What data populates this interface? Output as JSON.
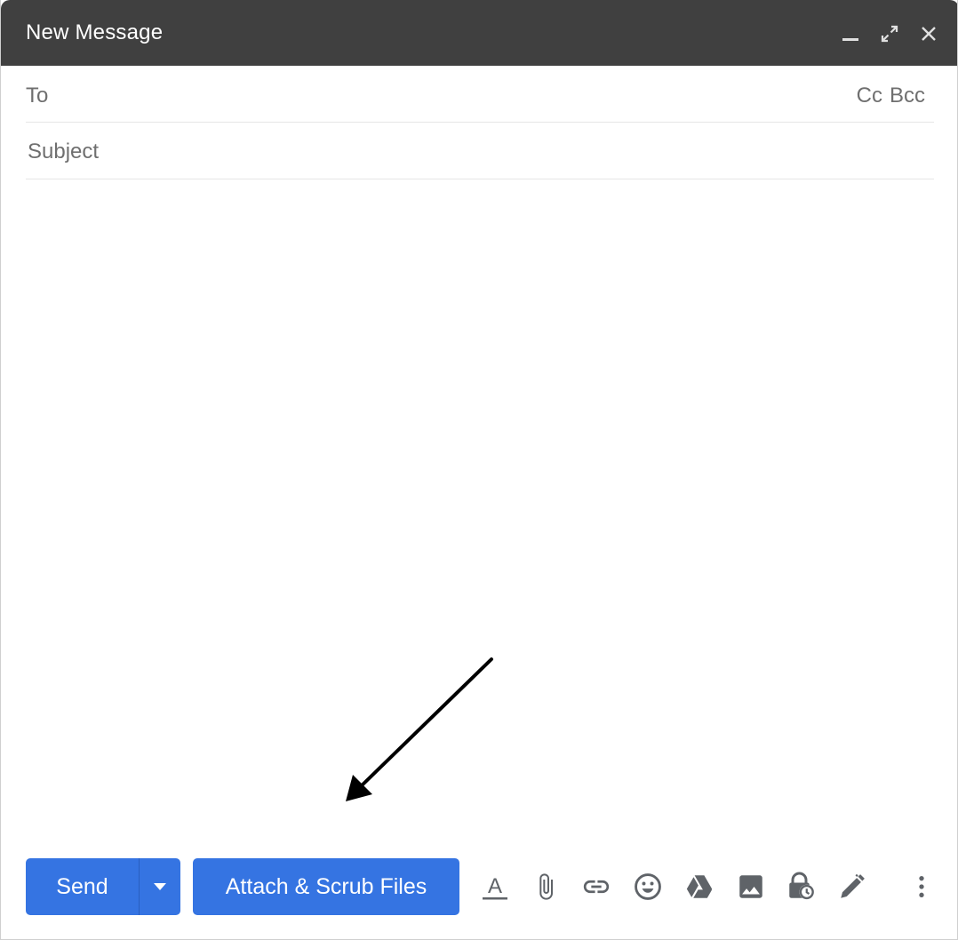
{
  "window": {
    "title": "New Message",
    "controls": [
      "minimize-icon",
      "expand-icon",
      "close-icon"
    ]
  },
  "to_field": {
    "label": "To",
    "value": "",
    "cc_label": "Cc",
    "bcc_label": "Bcc"
  },
  "subject_field": {
    "placeholder": "Subject",
    "value": ""
  },
  "body": {
    "value": ""
  },
  "toolbar": {
    "send_label": "Send",
    "attach_scrub_label": "Attach & Scrub Files",
    "icons": [
      "text-format-icon",
      "attach-file-icon",
      "insert-link-icon",
      "emoji-icon",
      "google-drive-icon",
      "insert-photo-icon",
      "confidential-mode-icon",
      "signature-icon",
      "more-options-icon"
    ]
  },
  "colors": {
    "titlebar": "#404040",
    "primary_button": "#3574e2",
    "label_gray": "#6f6f6f",
    "icon_gray": "#5f6368"
  }
}
